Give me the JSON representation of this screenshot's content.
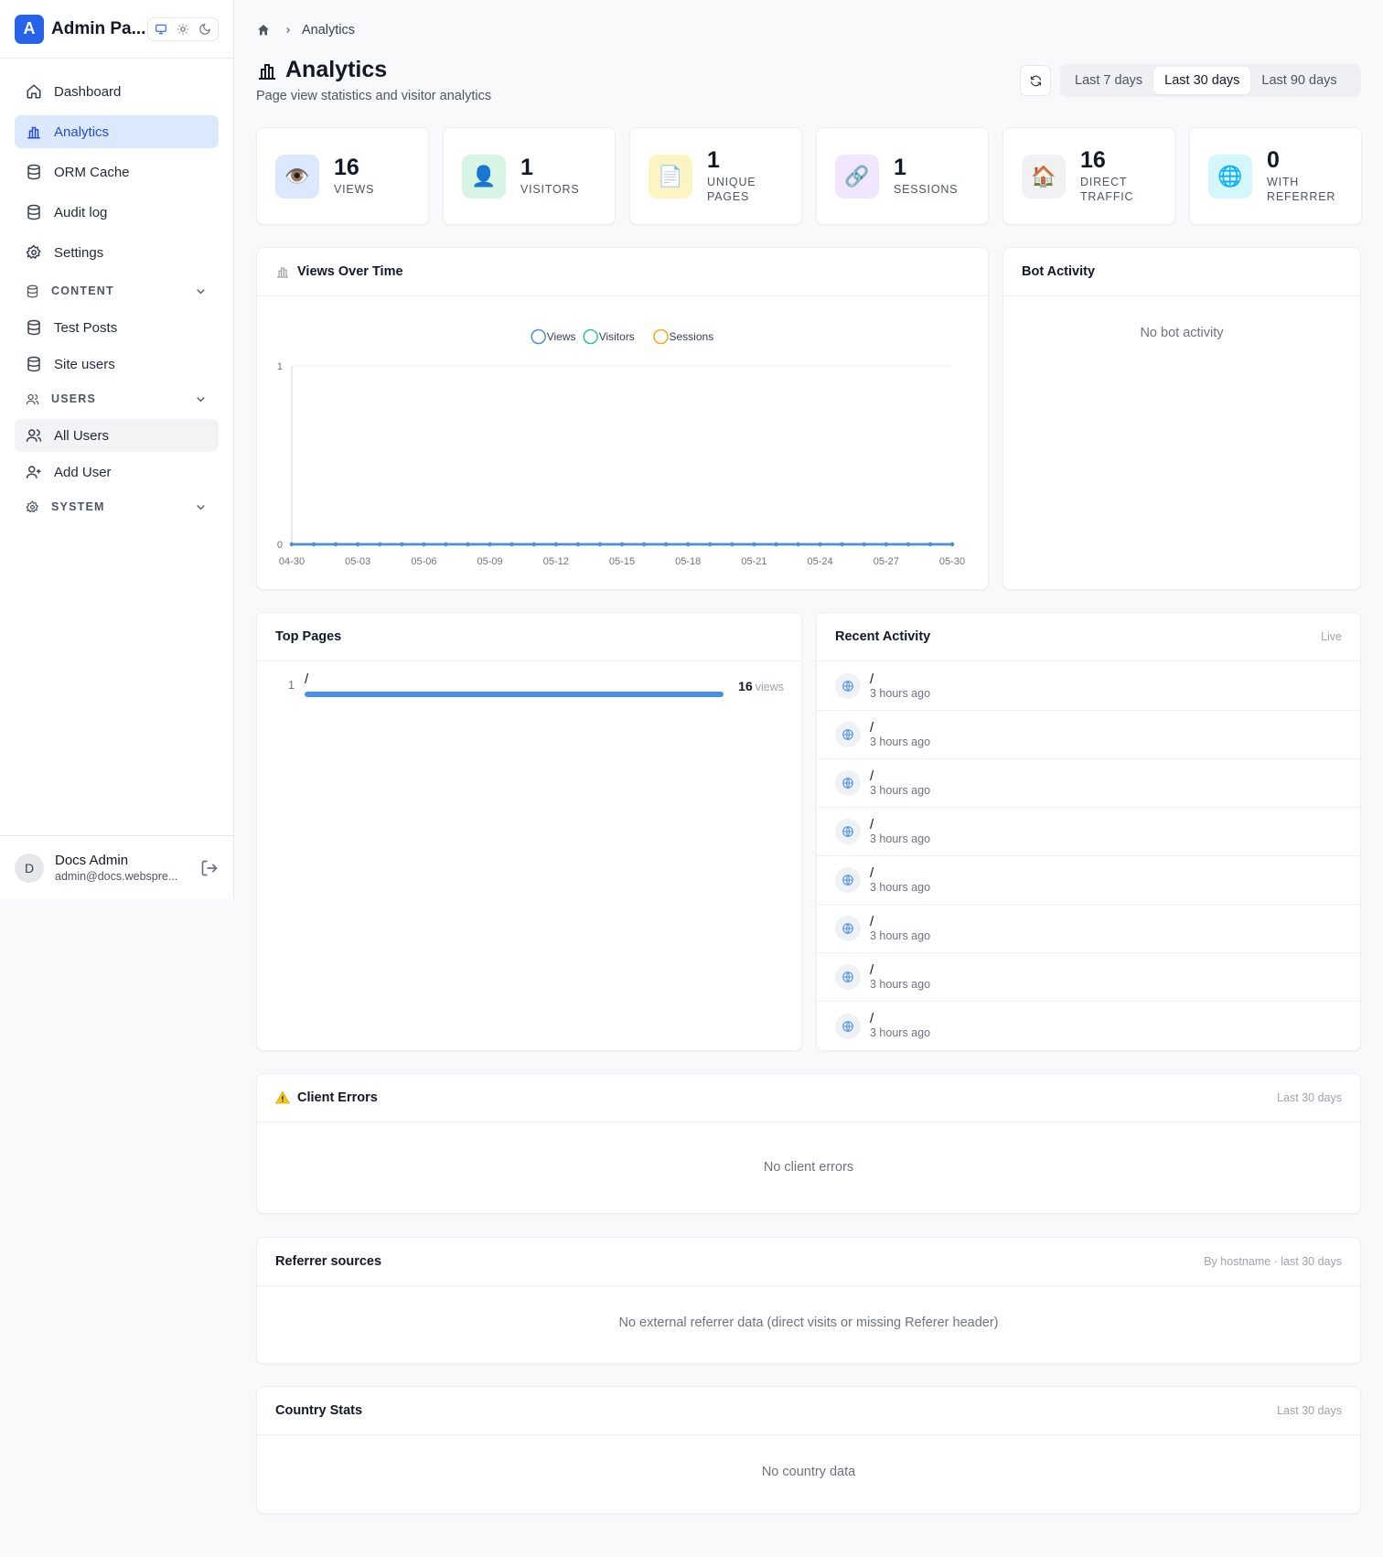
{
  "app": {
    "logo_letter": "A",
    "title": "Admin Pa..."
  },
  "sidebar": {
    "items_top": [
      {
        "label": "Dashboard",
        "icon": "home-icon"
      },
      {
        "label": "Analytics",
        "icon": "bar-chart-icon",
        "active": true
      },
      {
        "label": "ORM Cache",
        "icon": "database-icon"
      },
      {
        "label": "Audit log",
        "icon": "database-icon"
      },
      {
        "label": "Settings",
        "icon": "gear-icon"
      }
    ],
    "group_content": {
      "label": "CONTENT",
      "items": [
        {
          "label": "Test Posts"
        },
        {
          "label": "Site users"
        }
      ]
    },
    "group_users": {
      "label": "USERS",
      "items": [
        {
          "label": "All Users"
        },
        {
          "label": "Add User"
        }
      ]
    },
    "group_system": {
      "label": "SYSTEM"
    },
    "user": {
      "initial": "D",
      "name": "Docs Admin",
      "email": "admin@docs.webspre..."
    }
  },
  "header": {
    "breadcrumb_current": "Analytics",
    "title": "Analytics",
    "subtitle": "Page view statistics and visitor analytics",
    "ranges": [
      "Last 7 days",
      "Last 30 days",
      "Last 90 days"
    ],
    "active_range": 1
  },
  "stats": [
    {
      "value": "16",
      "label": "Views",
      "emoji": "👁️",
      "bg": "#dbe8fd"
    },
    {
      "value": "1",
      "label": "Visitors",
      "emoji": "👤",
      "bg": "#d8f5e4"
    },
    {
      "value": "1",
      "label": "Unique Pages",
      "emoji": "📄",
      "bg": "#fdf4c4"
    },
    {
      "value": "1",
      "label": "Sessions",
      "emoji": "🔗",
      "bg": "#f1e6fd"
    },
    {
      "value": "16",
      "label": "Direct Traffic",
      "emoji": "🏠",
      "bg": "#f0f1f3"
    },
    {
      "value": "0",
      "label": "With Referrer",
      "emoji": "🌐",
      "bg": "#d5f6fa"
    }
  ],
  "views_over_time": {
    "title": "Views Over Time"
  },
  "chart_data": {
    "type": "line",
    "x": [
      "04-30",
      "05-01",
      "05-02",
      "05-03",
      "05-04",
      "05-05",
      "05-06",
      "05-07",
      "05-08",
      "05-09",
      "05-10",
      "05-11",
      "05-12",
      "05-13",
      "05-14",
      "05-15",
      "05-16",
      "05-17",
      "05-18",
      "05-19",
      "05-20",
      "05-21",
      "05-22",
      "05-23",
      "05-24",
      "05-25",
      "05-26",
      "05-27",
      "05-28",
      "05-29",
      "05-30"
    ],
    "x_tick_labels": [
      "04-30",
      "05-03",
      "05-06",
      "05-09",
      "05-12",
      "05-15",
      "05-18",
      "05-21",
      "05-24",
      "05-27",
      "05-30"
    ],
    "y_tick_labels": [
      "0",
      "1"
    ],
    "ylim": [
      0,
      1
    ],
    "legend_position": "top-center",
    "grid": false,
    "series": [
      {
        "name": "Views",
        "color": "#4a90e2",
        "values": [
          0,
          0,
          0,
          0,
          0,
          0,
          0,
          0,
          0,
          0,
          0,
          0,
          0,
          0,
          0,
          0,
          0,
          0,
          0,
          0,
          0,
          0,
          0,
          0,
          0,
          0,
          0,
          0,
          0,
          0,
          0
        ]
      },
      {
        "name": "Visitors",
        "color": "#34c38f",
        "values": [
          0,
          0,
          0,
          0,
          0,
          0,
          0,
          0,
          0,
          0,
          0,
          0,
          0,
          0,
          0,
          0,
          0,
          0,
          0,
          0,
          0,
          0,
          0,
          0,
          0,
          0,
          0,
          0,
          0,
          0,
          0
        ]
      },
      {
        "name": "Sessions",
        "color": "#f5a623",
        "values": [
          0,
          0,
          0,
          0,
          0,
          0,
          0,
          0,
          0,
          0,
          0,
          0,
          0,
          0,
          0,
          0,
          0,
          0,
          0,
          0,
          0,
          0,
          0,
          0,
          0,
          0,
          0,
          0,
          0,
          0,
          0
        ]
      }
    ]
  },
  "bot_activity": {
    "title": "Bot Activity",
    "empty": "No bot activity"
  },
  "top_pages": {
    "title": "Top Pages",
    "rows": [
      {
        "rank": "1",
        "path": "/",
        "count": "16",
        "unit": "views",
        "fraction": 1.0
      }
    ]
  },
  "recent_activity": {
    "title": "Recent Activity",
    "badge": "Live",
    "items": [
      {
        "path": "/",
        "time": "3 hours ago"
      },
      {
        "path": "/",
        "time": "3 hours ago"
      },
      {
        "path": "/",
        "time": "3 hours ago"
      },
      {
        "path": "/",
        "time": "3 hours ago"
      },
      {
        "path": "/",
        "time": "3 hours ago"
      },
      {
        "path": "/",
        "time": "3 hours ago"
      },
      {
        "path": "/",
        "time": "3 hours ago"
      },
      {
        "path": "/",
        "time": "3 hours ago"
      }
    ]
  },
  "client_errors": {
    "title": "Client Errors",
    "right": "Last 30 days",
    "empty": "No client errors"
  },
  "referrers": {
    "title": "Referrer sources",
    "right": "By hostname · last 30 days",
    "empty": "No external referrer data (direct visits or missing Referer header)"
  },
  "country": {
    "title": "Country Stats",
    "right": "Last 30 days",
    "empty": "No country data"
  }
}
